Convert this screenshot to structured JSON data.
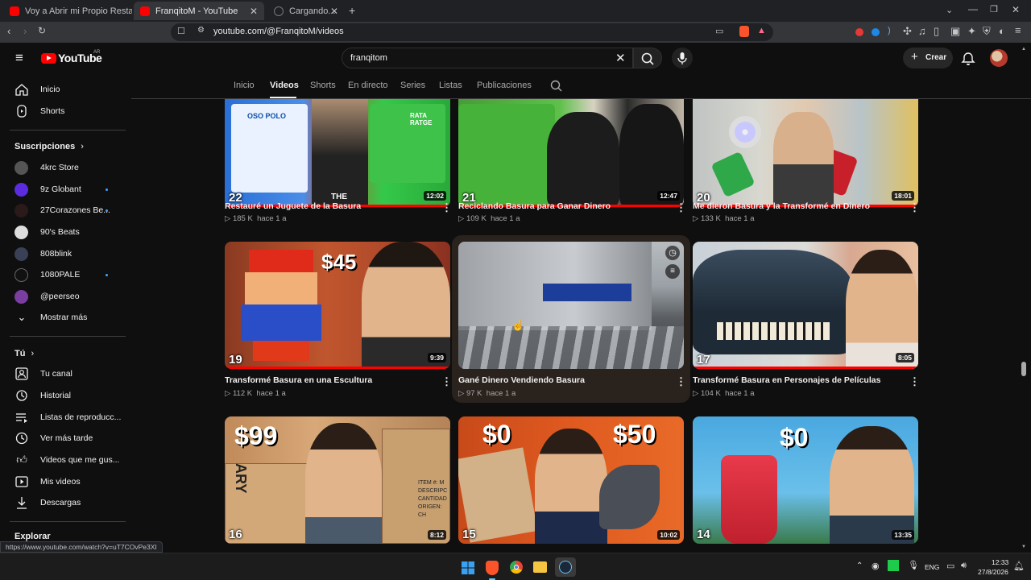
{
  "browser": {
    "tabs": [
      {
        "title": "Voy a Abrir mi Propio Restaurante - Y",
        "active": false
      },
      {
        "title": "FranqitoM - YouTube",
        "active": true
      },
      {
        "title": "Cargando...",
        "active": false
      }
    ],
    "new_tab": "+",
    "url": "youtube.com/@FranqitoM/videos",
    "status_url": "https://www.youtube.com/watch?v=uT7COvPe3XI"
  },
  "youtube": {
    "logo": "YouTube",
    "logo_region": "AR",
    "search_value": "franqitom",
    "create_label": "Crear",
    "sidebar": {
      "main": [
        {
          "label": "Inicio",
          "icon": "home-icon"
        },
        {
          "label": "Shorts",
          "icon": "shorts-icon"
        }
      ],
      "subs_header": "Suscripciones",
      "subs": [
        {
          "label": "4krc Store",
          "color": "#555",
          "dot": false
        },
        {
          "label": "9z Globant",
          "color": "#5b2be0",
          "dot": true
        },
        {
          "label": "27Corazones Be...",
          "color": "#222",
          "dot": true
        },
        {
          "label": "90's Beats",
          "color": "#ddd",
          "dot": false
        },
        {
          "label": "808blink",
          "color": "#334",
          "dot": false
        },
        {
          "label": "1080PALE",
          "color": "#111",
          "dot": true
        },
        {
          "label": "@peerseo",
          "color": "#7a3ea0",
          "dot": false
        },
        {
          "label": "Mostrar más",
          "color": "",
          "dot": false
        }
      ],
      "you_header": "Tú",
      "you": [
        {
          "label": "Tu canal",
          "icon": "channel-icon"
        },
        {
          "label": "Historial",
          "icon": "history-icon"
        },
        {
          "label": "Listas de reproducc...",
          "icon": "playlists-icon"
        },
        {
          "label": "Ver más tarde",
          "icon": "watch-later-icon"
        },
        {
          "label": "Videos que me gus...",
          "icon": "like-icon"
        },
        {
          "label": "Mis videos",
          "icon": "my-videos-icon"
        },
        {
          "label": "Descargas",
          "icon": "downloads-icon"
        }
      ],
      "explore_header": "Explorar"
    },
    "channel_tabs": [
      "Inicio",
      "Videos",
      "Shorts",
      "En directo",
      "Series",
      "Listas",
      "Publicaciones"
    ],
    "active_tab": "Videos",
    "videos": [
      {
        "title": "Restauré un Juguete de la Basura",
        "views": "185 K",
        "age": "hace 1 a",
        "duration": "12:02",
        "number": "22",
        "progress": 1.0
      },
      {
        "title": "Reciclando Basura para Ganar Dinero",
        "views": "109 K",
        "age": "hace 1 a",
        "duration": "12:47",
        "number": "21",
        "progress": 1.0
      },
      {
        "title": "Me dieron Basura y la Transformé en Dinero",
        "views": "133 K",
        "age": "hace 1 a",
        "duration": "18:01",
        "number": "20",
        "progress": 1.0
      },
      {
        "title": "Transformé Basura en una Escultura",
        "views": "112 K",
        "age": "hace 1 a",
        "duration": "9:39",
        "number": "19",
        "progress": 1.0
      },
      {
        "title": "Gané Dinero Vendiendo Basura",
        "views": "97 K",
        "age": "hace 1 a",
        "duration": "",
        "number": "",
        "progress": 0
      },
      {
        "title": "Transformé Basura en Personajes de Películas",
        "views": "104 K",
        "age": "hace 1 a",
        "duration": "8:05",
        "number": "17",
        "progress": 1.0
      },
      {
        "title": "",
        "views": "",
        "age": "",
        "duration": "8:12",
        "number": "16",
        "progress": 0
      },
      {
        "title": "",
        "views": "",
        "age": "",
        "duration": "10:02",
        "number": "15",
        "progress": 0
      },
      {
        "title": "",
        "views": "",
        "age": "",
        "duration": "13:35",
        "number": "14",
        "progress": 0
      }
    ],
    "thumb_text": {
      "v1_left": "OSO POLO",
      "v1_right": "RATA RATGE",
      "v1_bottom": "THE",
      "v4_price": "$45",
      "v7_price": "$99",
      "v7_box": "ARY",
      "v7_label": "ITEM #: M DESCRIPC CANTIDAD ORIGEN: CH",
      "v8_left": "$0",
      "v8_right": "$50",
      "v9_price": "$0"
    }
  },
  "taskbar": {
    "lang": "ENG",
    "time": "12:33",
    "date": "27/8/2026"
  }
}
